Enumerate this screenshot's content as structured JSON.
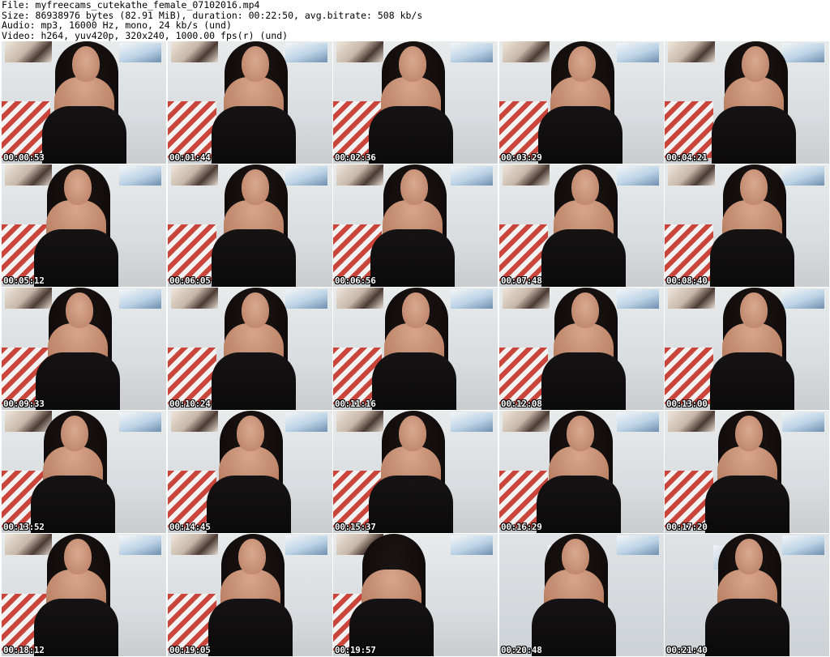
{
  "header": {
    "file": "File: myfreecams_cutekathe_female_07102016.mp4",
    "size": "Size: 86938976 bytes (82.91 MiB), duration: 00:22:50, avg.bitrate: 508 kb/s",
    "audio": "Audio: mp3, 16000 Hz, mono, 24 kb/s (und)",
    "video": "Video: h264, yuv420p, 320x240, 1000.00 fps(r) (und)"
  },
  "thumbnails": [
    {
      "timestamp": "00:00:53"
    },
    {
      "timestamp": "00:01:44"
    },
    {
      "timestamp": "00:02:36"
    },
    {
      "timestamp": "00:03:29"
    },
    {
      "timestamp": "00:04:21"
    },
    {
      "timestamp": "00:05:12"
    },
    {
      "timestamp": "00:06:05"
    },
    {
      "timestamp": "00:06:56"
    },
    {
      "timestamp": "00:07:48"
    },
    {
      "timestamp": "00:08:40"
    },
    {
      "timestamp": "00:09:33"
    },
    {
      "timestamp": "00:10:24"
    },
    {
      "timestamp": "00:11:16"
    },
    {
      "timestamp": "00:12:08"
    },
    {
      "timestamp": "00:13:00"
    },
    {
      "timestamp": "00:13:52"
    },
    {
      "timestamp": "00:14:45"
    },
    {
      "timestamp": "00:15:37"
    },
    {
      "timestamp": "00:16:29"
    },
    {
      "timestamp": "00:17:20"
    },
    {
      "timestamp": "00:18:12"
    },
    {
      "timestamp": "00:19:05"
    },
    {
      "timestamp": "00:19:57"
    },
    {
      "timestamp": "00:20:48"
    },
    {
      "timestamp": "00:21:40"
    }
  ]
}
